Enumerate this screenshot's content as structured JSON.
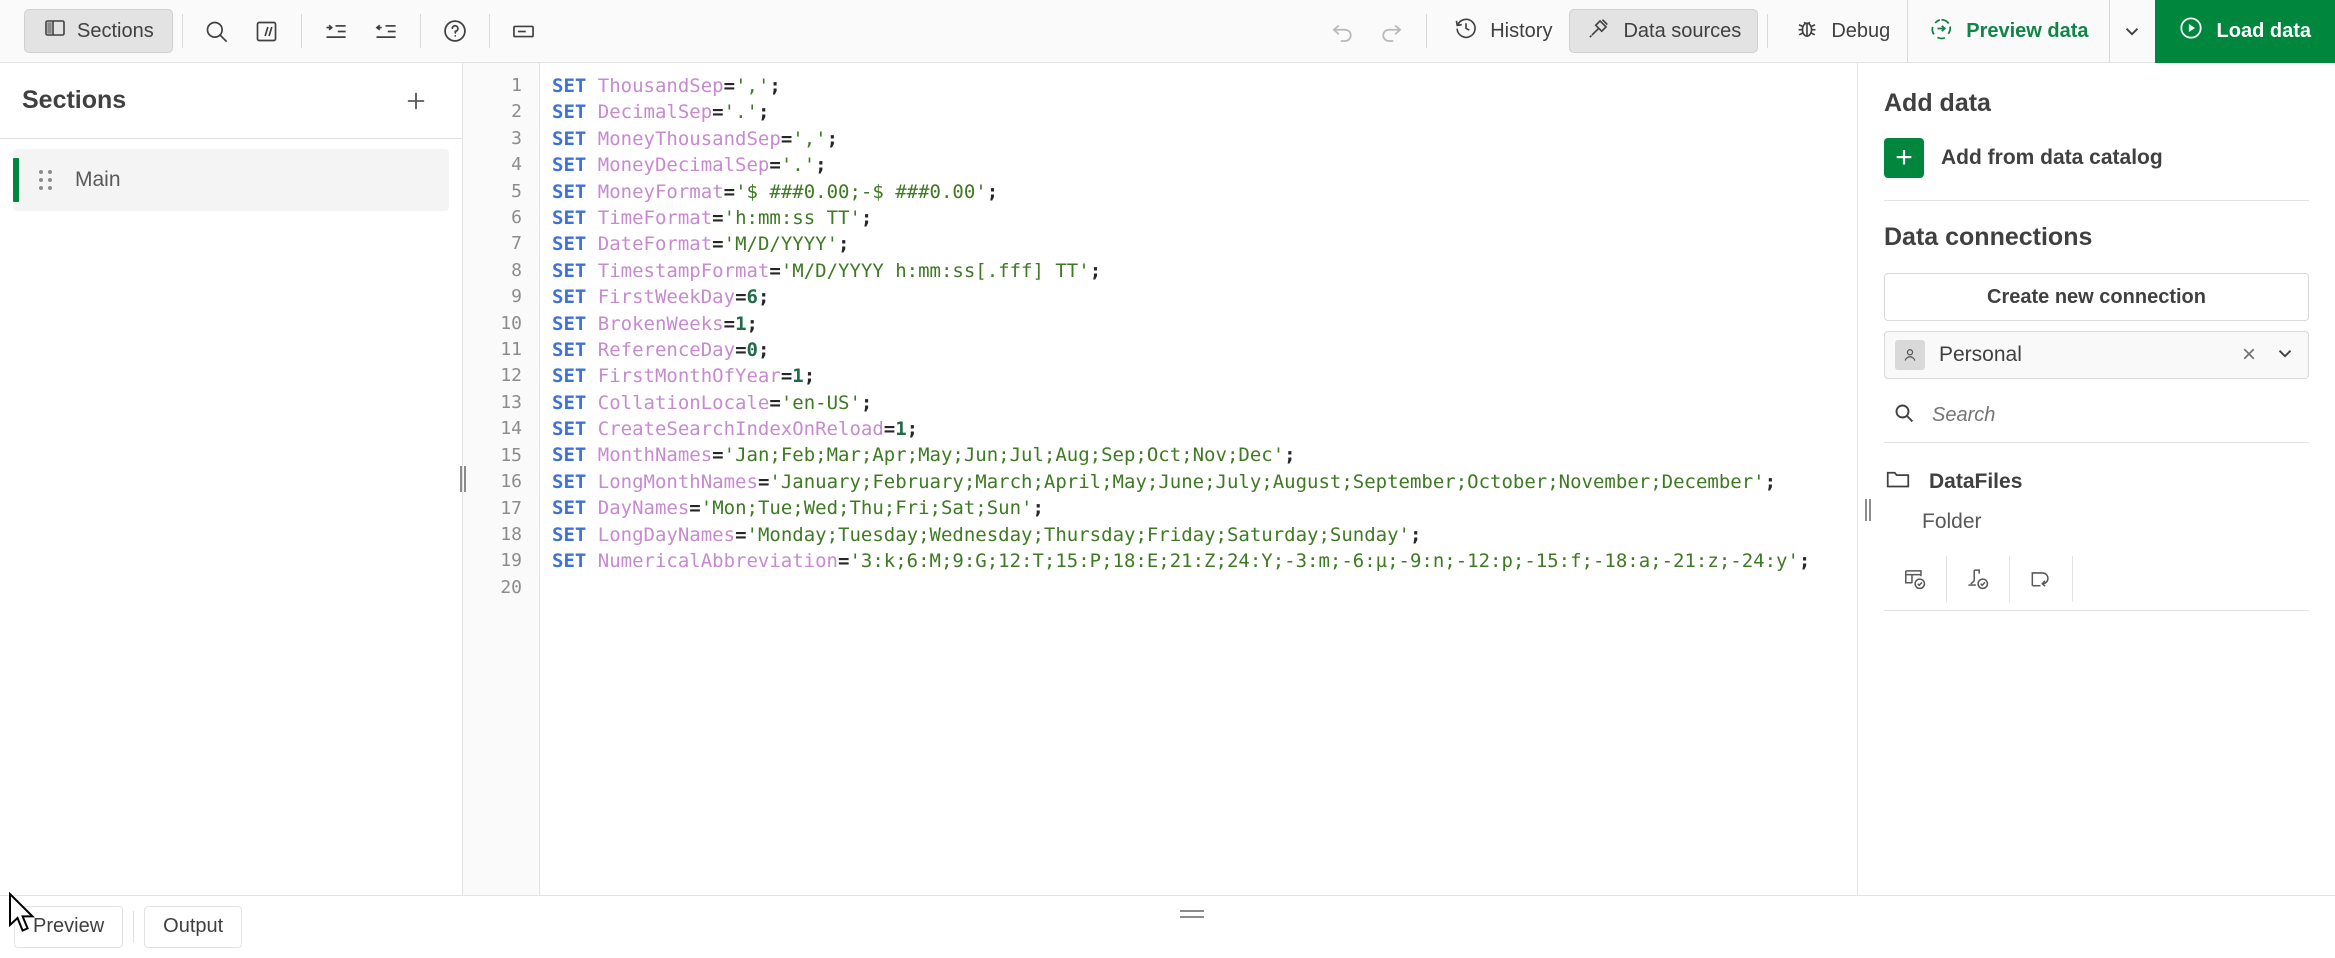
{
  "toolbar": {
    "sections_button": "Sections",
    "icons": [
      {
        "name": "search-icon",
        "title": "Search"
      },
      {
        "name": "comment-icon",
        "title": "Comment"
      },
      {
        "name": "indent-increase-icon",
        "title": "Indent"
      },
      {
        "name": "indent-decrease-icon",
        "title": "Outdent"
      },
      {
        "name": "help-icon",
        "title": "Help"
      },
      {
        "name": "variables-icon",
        "title": "Variables"
      }
    ],
    "undo_label": "Undo",
    "redo_label": "Redo",
    "history_label": "History",
    "data_sources_label": "Data sources",
    "debug_label": "Debug",
    "preview_data_label": "Preview data",
    "load_data_label": "Load data",
    "accent_green": "#00873d",
    "preview_green": "#108548"
  },
  "sections": {
    "title": "Sections",
    "add_label": "+",
    "items": [
      {
        "label": "Main",
        "active": true
      }
    ]
  },
  "editor": {
    "line_numbers": [
      "1",
      "2",
      "3",
      "4",
      "5",
      "6",
      "7",
      "8",
      "9",
      "10",
      "11",
      "12",
      "13",
      "14",
      "15",
      "16",
      "17",
      "18",
      "19",
      "20"
    ],
    "lines": [
      {
        "n": 1,
        "kw": "SET",
        "var": "ThousandSep",
        "op": "=",
        "val": "','",
        "val_type": "str",
        "end": ";"
      },
      {
        "n": 2,
        "kw": "SET",
        "var": "DecimalSep",
        "op": "=",
        "val": "'.'",
        "val_type": "str",
        "end": ";"
      },
      {
        "n": 3,
        "kw": "SET",
        "var": "MoneyThousandSep",
        "op": "=",
        "val": "','",
        "val_type": "str",
        "end": ";"
      },
      {
        "n": 4,
        "kw": "SET",
        "var": "MoneyDecimalSep",
        "op": "=",
        "val": "'.'",
        "val_type": "str",
        "end": ";"
      },
      {
        "n": 5,
        "kw": "SET",
        "var": "MoneyFormat",
        "op": "=",
        "val": "'$ ###0.00;-$ ###0.00'",
        "val_type": "str",
        "end": ";"
      },
      {
        "n": 6,
        "kw": "SET",
        "var": "TimeFormat",
        "op": "=",
        "val": "'h:mm:ss TT'",
        "val_type": "str",
        "end": ";"
      },
      {
        "n": 7,
        "kw": "SET",
        "var": "DateFormat",
        "op": "=",
        "val": "'M/D/YYYY'",
        "val_type": "str",
        "end": ";"
      },
      {
        "n": 8,
        "kw": "SET",
        "var": "TimestampFormat",
        "op": "=",
        "val": "'M/D/YYYY h:mm:ss[.fff] TT'",
        "val_type": "str",
        "end": ";"
      },
      {
        "n": 9,
        "kw": "SET",
        "var": "FirstWeekDay",
        "op": "=",
        "val": "6",
        "val_type": "num",
        "end": ";"
      },
      {
        "n": 10,
        "kw": "SET",
        "var": "BrokenWeeks",
        "op": "=",
        "val": "1",
        "val_type": "num",
        "end": ";"
      },
      {
        "n": 11,
        "kw": "SET",
        "var": "ReferenceDay",
        "op": "=",
        "val": "0",
        "val_type": "num",
        "end": ";"
      },
      {
        "n": 12,
        "kw": "SET",
        "var": "FirstMonthOfYear",
        "op": "=",
        "val": "1",
        "val_type": "num",
        "end": ";"
      },
      {
        "n": 13,
        "kw": "SET",
        "var": "CollationLocale",
        "op": "=",
        "val": "'en-US'",
        "val_type": "str",
        "end": ";"
      },
      {
        "n": 14,
        "kw": "SET",
        "var": "CreateSearchIndexOnReload",
        "op": "=",
        "val": "1",
        "val_type": "num",
        "end": ";"
      },
      {
        "n": 15,
        "kw": "SET",
        "var": "MonthNames",
        "op": "=",
        "val": "'Jan;Feb;Mar;Apr;May;Jun;Jul;Aug;Sep;Oct;Nov;Dec'",
        "val_type": "str",
        "end": ";"
      },
      {
        "n": 16,
        "kw": "SET",
        "var": "LongMonthNames",
        "op": "=",
        "val": "'January;February;March;April;May;June;July;August;September;October;November;December'",
        "val_type": "str",
        "end": ";"
      },
      {
        "n": 17,
        "kw": "SET",
        "var": "DayNames",
        "op": "=",
        "val": "'Mon;Tue;Wed;Thu;Fri;Sat;Sun'",
        "val_type": "str",
        "end": ";"
      },
      {
        "n": 18,
        "kw": "SET",
        "var": "LongDayNames",
        "op": "=",
        "val": "'Monday;Tuesday;Wednesday;Thursday;Friday;Saturday;Sunday'",
        "val_type": "str",
        "end": ";"
      },
      {
        "n": 19,
        "kw": "SET",
        "var": "NumericalAbbreviation",
        "op": "=",
        "val": "'3:k;6:M;9:G;12:T;15:P;18:E;21:Z;24:Y;-3:m;-6:µ;-9:n;-12:p;-15:f;-18:a;-21:z;-24:y'",
        "val_type": "str",
        "end": ";"
      },
      {
        "n": 20,
        "kw": "",
        "var": "",
        "op": "",
        "val": "",
        "val_type": "str",
        "end": ""
      }
    ],
    "syntax_colors": {
      "keyword": "#3f72d8",
      "variable": "#c78ad0",
      "operator": "#262626",
      "string": "#3d7a22",
      "number": "#1f6b4a",
      "line_number": "#8c8c8c"
    }
  },
  "right_panel": {
    "add_data_title": "Add data",
    "add_from_catalog": "Add from data catalog",
    "data_connections_title": "Data connections",
    "create_new_connection": "Create new connection",
    "selected_connection": "Personal",
    "clear_label": "×",
    "search_placeholder": "Search",
    "search_value": "",
    "folder_name": "DataFiles",
    "folder_type": "Folder",
    "connection_actions": [
      {
        "name": "select-data-icon"
      },
      {
        "name": "insert-script-icon"
      },
      {
        "name": "edit-connection-icon"
      }
    ]
  },
  "bottom_bar": {
    "preview_tab": "Preview",
    "output_tab": "Output"
  }
}
